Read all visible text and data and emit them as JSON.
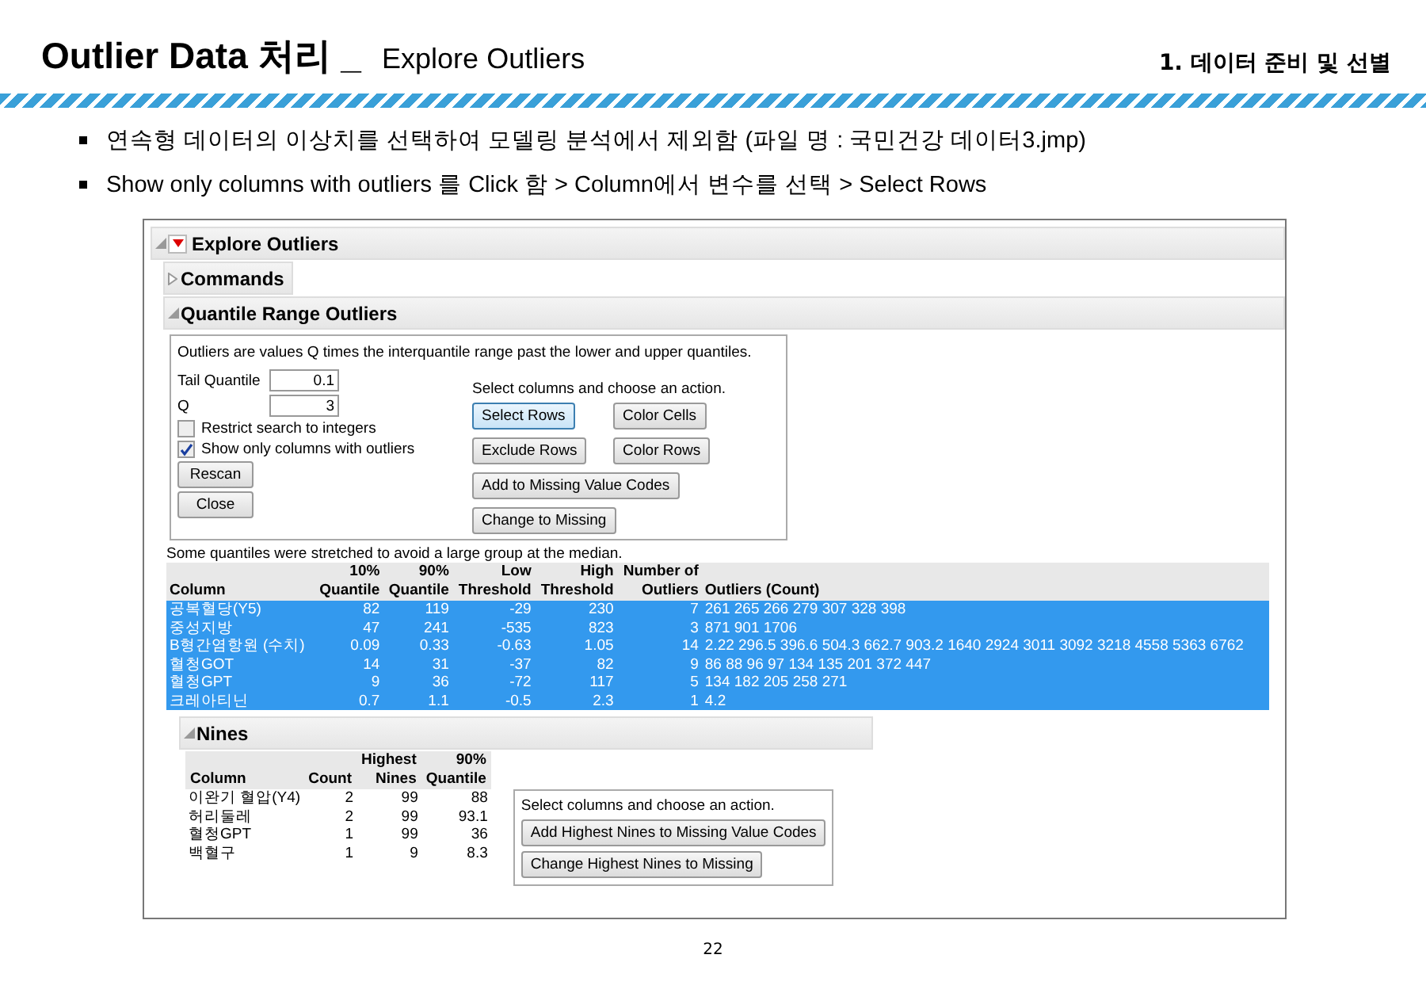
{
  "slide": {
    "title": "Outlier Data 처리 _",
    "subtitle": "Explore Outliers",
    "section": "1. 데이터 준비 및 선별",
    "bullets": [
      "연속형 데이터의 이상치를 선택하여 모델링 분석에서 제외함 (파일 명 : 국민건강 데이터3.jmp)",
      "Show only columns with outliers 를 Click 함 > Column에서 변수를 선택 > Select Rows"
    ],
    "page_number": "22"
  },
  "report": {
    "title": "Explore Outliers",
    "commands": {
      "title": "Commands",
      "expanded": false
    },
    "quantile": {
      "title": "Quantile Range Outliers",
      "expanded": true,
      "description": "Outliers are values Q times the interquantile range past the lower and upper quantiles.",
      "fields": [
        {
          "label": "Tail Quantile",
          "value": "0.1"
        },
        {
          "label": "Q",
          "value": "3"
        }
      ],
      "checkboxes": [
        {
          "label": "Restrict search to integers",
          "checked": false
        },
        {
          "label": "Show only columns with outliers",
          "checked": true
        }
      ],
      "left_buttons": [
        "Rescan",
        "Close"
      ],
      "action_hint": "Select columns and choose an action.",
      "action_buttons": [
        {
          "label": "Select Rows",
          "selected": true
        },
        {
          "label": "Color Cells",
          "selected": false
        },
        {
          "label": "Exclude Rows",
          "selected": false
        },
        {
          "label": "Color Rows",
          "selected": false
        },
        {
          "label": "Add to Missing Value Codes",
          "selected": false
        },
        {
          "label": "Change to Missing",
          "selected": false
        }
      ],
      "note": "Some quantiles were stretched to avoid a large group at the median.",
      "columns": [
        "Column",
        "10%\nQuantile",
        "90%\nQuantile",
        "Low\nThreshold",
        "High\nThreshold",
        "Number of\nOutliers",
        "Outliers (Count)"
      ],
      "rows": [
        {
          "cells": [
            "공복혈당(Y5)",
            "82",
            "119",
            "-29",
            "230",
            "7",
            "261 265 266 279 307 328 398"
          ],
          "selected": true
        },
        {
          "cells": [
            "중성지방",
            "47",
            "241",
            "-535",
            "823",
            "3",
            "871 901 1706"
          ],
          "selected": true
        },
        {
          "cells": [
            "B형간염항원 (수치)",
            "0.09",
            "0.33",
            "-0.63",
            "1.05",
            "14",
            "2.22 296.5 396.6 504.3 662.7 903.2 1640 2924 3011 3092 3218 4558 5363 6762"
          ],
          "selected": true
        },
        {
          "cells": [
            "혈청GOT",
            "14",
            "31",
            "-37",
            "82",
            "9",
            "86 88 96 97 134 135 201 372 447"
          ],
          "selected": true
        },
        {
          "cells": [
            "혈청GPT",
            "9",
            "36",
            "-72",
            "117",
            "5",
            "134 182 205 258 271"
          ],
          "selected": true
        },
        {
          "cells": [
            "크레아티닌",
            "0.7",
            "1.1",
            "-0.5",
            "2.3",
            "1",
            "4.2"
          ],
          "selected": true
        }
      ]
    },
    "nines": {
      "title": "Nines",
      "expanded": true,
      "columns": [
        "Column",
        "Count",
        "Highest\nNines",
        "90%\nQuantile"
      ],
      "rows": [
        {
          "cells": [
            "이완기 혈압(Y4)",
            "2",
            "99",
            "88"
          ],
          "selected": false
        },
        {
          "cells": [
            "허리둘레",
            "2",
            "99",
            "93.1"
          ],
          "selected": false
        },
        {
          "cells": [
            "혈청GPT",
            "1",
            "99",
            "36"
          ],
          "selected": false
        },
        {
          "cells": [
            "백혈구",
            "1",
            "9",
            "8.3"
          ],
          "selected": false
        }
      ],
      "action_hint": "Select columns and choose an action.",
      "buttons": [
        "Add Highest Nines to Missing Value Codes",
        "Change Highest Nines to Missing"
      ]
    }
  }
}
